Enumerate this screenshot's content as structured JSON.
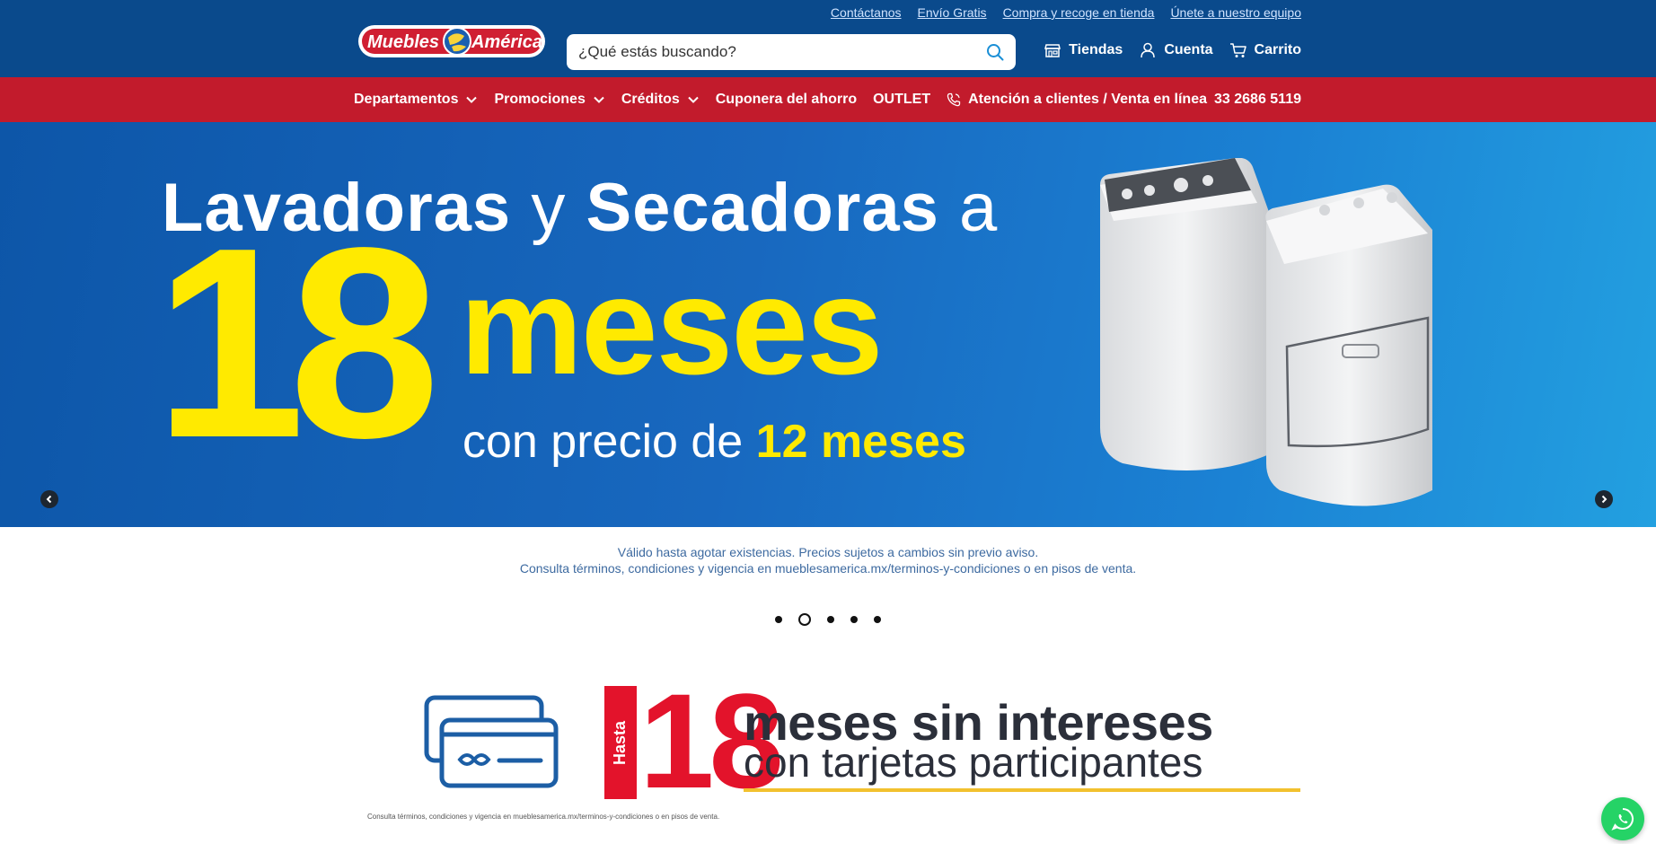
{
  "header": {
    "top_links": [
      {
        "label": "Contáctanos",
        "name": "top-link-contactanos"
      },
      {
        "label": "Envío Gratis",
        "name": "top-link-envio-gratis"
      },
      {
        "label": "Compra y recoge en tienda",
        "name": "top-link-compra-recoge"
      },
      {
        "label": "Únete a nuestro equipo",
        "name": "top-link-unete"
      }
    ],
    "logo_text": "Muebles América",
    "search": {
      "placeholder": "¿Qué estás buscando?",
      "value": ""
    },
    "actions": [
      {
        "label": "Tiendas",
        "icon": "store-icon",
        "name": "header-tiendas"
      },
      {
        "label": "Cuenta",
        "icon": "user-icon",
        "name": "header-cuenta"
      },
      {
        "label": "Carrito",
        "icon": "cart-icon",
        "name": "header-carrito"
      }
    ]
  },
  "nav": {
    "items": [
      {
        "label": "Departamentos",
        "dropdown": true,
        "name": "nav-departamentos"
      },
      {
        "label": "Promociones",
        "dropdown": true,
        "name": "nav-promociones"
      },
      {
        "label": "Créditos",
        "dropdown": true,
        "name": "nav-creditos"
      },
      {
        "label": "Cuponera del ahorro",
        "dropdown": false,
        "name": "nav-cuponera"
      },
      {
        "label": "OUTLET",
        "dropdown": false,
        "name": "nav-outlet"
      }
    ],
    "contact_label": "Atención a clientes / Venta en línea",
    "contact_phone": "33 2686 5119"
  },
  "hero": {
    "word1": "Lavadoras",
    "word2": "y",
    "word3": "Secadoras",
    "word4": "a",
    "number": "18",
    "unit": "meses",
    "sub_prefix": "con precio de",
    "sub_highlight": "12 meses"
  },
  "disclaimer": {
    "line1": "Válido hasta agotar existencias. Precios sujetos a cambios sin previo aviso.",
    "line2": "Consulta términos, condiciones y vigencia en mueblesamerica.mx/terminos-y-condiciones o en pisos de venta."
  },
  "carousel": {
    "slide_count": 5,
    "active_index": 1
  },
  "promo": {
    "hasta": "Hasta",
    "number": "18",
    "title": "meses sin intereses",
    "subtitle": "con tarjetas participantes",
    "fine_print": "Consulta términos, condiciones y vigencia en mueblesamerica.mx/terminos-y-condiciones  o en pisos de venta."
  },
  "colors": {
    "header_blue": "#0a4a8c",
    "nav_red": "#c21b2c",
    "hero_yellow": "#ffea00",
    "promo_red": "#e3132b",
    "whatsapp_green": "#25d366"
  }
}
